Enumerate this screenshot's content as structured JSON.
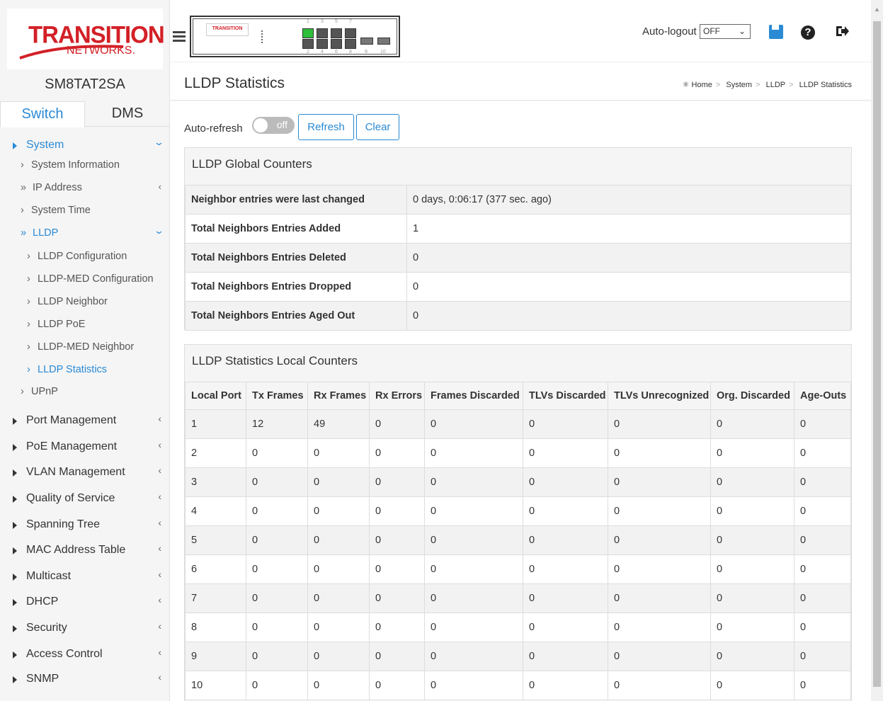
{
  "brand": {
    "logo_text": "TRANSITION",
    "logo_sub": "NETWORKS."
  },
  "device_name": "SM8TAT2SA",
  "tabs": [
    {
      "label": "Switch"
    },
    {
      "label": "DMS"
    }
  ],
  "nav": {
    "system": "System",
    "system_information": "System Information",
    "ip_address": "IP Address",
    "system_time": "System Time",
    "lldp": "LLDP",
    "lldp_items": [
      "LLDP Configuration",
      "LLDP-MED Configuration",
      "LLDP Neighbor",
      "LLDP PoE",
      "LLDP-MED Neighbor",
      "LLDP Statistics"
    ],
    "upnp": "UPnP",
    "groups": [
      "Port Management",
      "PoE Management",
      "VLAN Management",
      "Quality of Service",
      "Spanning Tree",
      "MAC Address Table",
      "Multicast",
      "DHCP",
      "Security",
      "Access Control",
      "SNMP"
    ]
  },
  "topbar": {
    "autologout_label": "Auto-logout",
    "autologout_value": "OFF",
    "panel_logo": "TRANSITION",
    "port_numbers_top": [
      "1",
      "3",
      "5",
      "7"
    ],
    "port_numbers_bottom": [
      "2",
      "4",
      "6",
      "8",
      "9",
      "10"
    ]
  },
  "page": {
    "title": "LLDP Statistics",
    "breadcrumb": [
      "Home",
      "System",
      "LLDP",
      "LLDP Statistics"
    ],
    "auto_refresh_label": "Auto-refresh",
    "toggle_text": "off",
    "refresh_label": "Refresh",
    "clear_label": "Clear"
  },
  "global_counters": {
    "title": "LLDP Global Counters",
    "rows": [
      {
        "label": "Neighbor entries were last changed",
        "value": "0 days, 0:06:17 (377 sec. ago)"
      },
      {
        "label": "Total Neighbors Entries Added",
        "value": "1"
      },
      {
        "label": "Total Neighbors Entries Deleted",
        "value": "0"
      },
      {
        "label": "Total Neighbors Entries Dropped",
        "value": "0"
      },
      {
        "label": "Total Neighbors Entries Aged Out",
        "value": "0"
      }
    ]
  },
  "local_counters": {
    "title": "LLDP Statistics Local Counters",
    "headers": [
      "Local Port",
      "Tx Frames",
      "Rx Frames",
      "Rx Errors",
      "Frames Discarded",
      "TLVs Discarded",
      "TLVs Unrecognized",
      "Org. Discarded",
      "Age-Outs"
    ],
    "rows": [
      [
        "1",
        "12",
        "49",
        "0",
        "0",
        "0",
        "0",
        "0",
        "0"
      ],
      [
        "2",
        "0",
        "0",
        "0",
        "0",
        "0",
        "0",
        "0",
        "0"
      ],
      [
        "3",
        "0",
        "0",
        "0",
        "0",
        "0",
        "0",
        "0",
        "0"
      ],
      [
        "4",
        "0",
        "0",
        "0",
        "0",
        "0",
        "0",
        "0",
        "0"
      ],
      [
        "5",
        "0",
        "0",
        "0",
        "0",
        "0",
        "0",
        "0",
        "0"
      ],
      [
        "6",
        "0",
        "0",
        "0",
        "0",
        "0",
        "0",
        "0",
        "0"
      ],
      [
        "7",
        "0",
        "0",
        "0",
        "0",
        "0",
        "0",
        "0",
        "0"
      ],
      [
        "8",
        "0",
        "0",
        "0",
        "0",
        "0",
        "0",
        "0",
        "0"
      ],
      [
        "9",
        "0",
        "0",
        "0",
        "0",
        "0",
        "0",
        "0",
        "0"
      ],
      [
        "10",
        "0",
        "0",
        "0",
        "0",
        "0",
        "0",
        "0",
        "0"
      ]
    ]
  },
  "colors": {
    "accent": "#2a8ad4",
    "brand_red": "#d32027",
    "port_active": "#2dbf3a"
  }
}
